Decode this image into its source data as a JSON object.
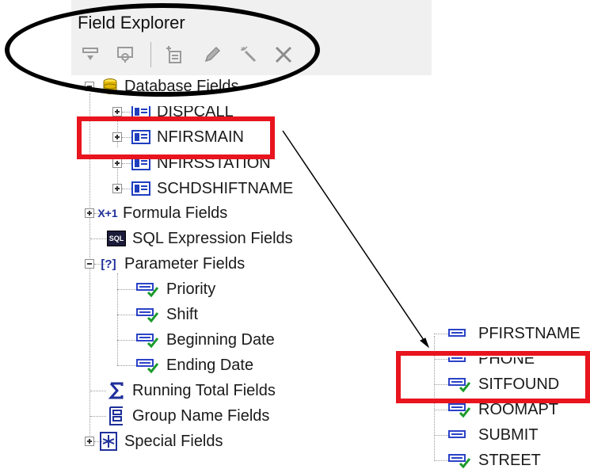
{
  "panel": {
    "title": "Field Explorer",
    "toolbar": [
      {
        "name": "insert-to-report-icon"
      },
      {
        "name": "browse-data-icon"
      },
      {
        "name": "new-field-icon"
      },
      {
        "name": "edit-field-icon"
      },
      {
        "name": "rename-field-icon"
      },
      {
        "name": "delete-field-icon"
      }
    ]
  },
  "tree": {
    "database_fields": "Database Fields",
    "tables": [
      "DISPCALL",
      "NFIRSMAIN",
      "NFIRSSTATION",
      "SCHDSHIFTNAME"
    ],
    "formula_fields": "Formula Fields",
    "formula_icon_text": "X+1",
    "sql_expression_fields": "SQL Expression Fields",
    "sql_icon_text": "SQL",
    "parameter_fields": "Parameter Fields",
    "parameter_icon_text": "[?]",
    "parameters": [
      "Priority",
      "Shift",
      "Beginning Date",
      "Ending Date"
    ],
    "running_total_fields": "Running Total Fields",
    "group_name_fields": "Group Name Fields",
    "special_fields": "Special Fields"
  },
  "field_list": [
    "PFIRSTNAME",
    "PHONE",
    "SITFOUND",
    "ROOMAPT",
    "SUBMIT",
    "STREET"
  ],
  "field_list_checked": [
    false,
    false,
    true,
    true,
    false,
    true
  ],
  "colors": {
    "highlight": "#e8141e",
    "annotation": "#000000",
    "field_icon": "#2b43c8",
    "check": "#1a9a2a"
  }
}
